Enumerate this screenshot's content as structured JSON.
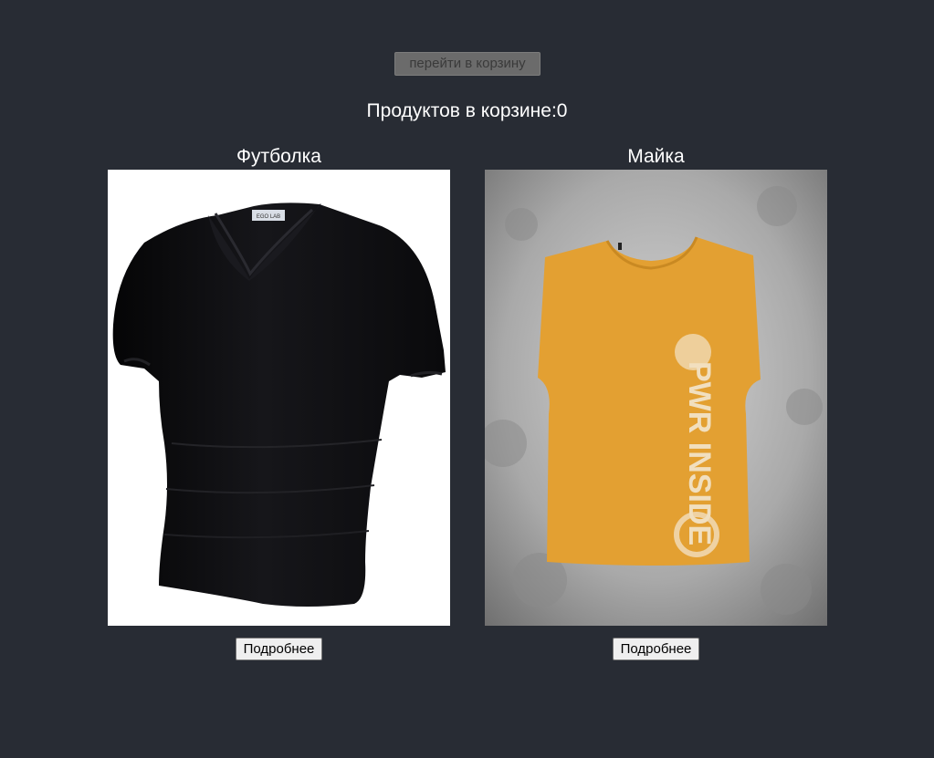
{
  "header": {
    "cart_link_label": "перейти в корзину",
    "cart_count_text": "Продуктов в корзине:0"
  },
  "products": [
    {
      "title": "Футболка",
      "image_desc": "black-v-neck-tshirt",
      "details_label": "Подробнее"
    },
    {
      "title": "Майка",
      "image_desc": "orange-sleeveless-tank-top",
      "image_print_text": "PWR INSIDE",
      "details_label": "Подробнее"
    }
  ],
  "colors": {
    "background": "#282c34",
    "text": "#ffffff",
    "cart_button_bg": "#6b6b6b",
    "tank_top": "#e3a032",
    "tshirt": "#0c0c0e"
  }
}
